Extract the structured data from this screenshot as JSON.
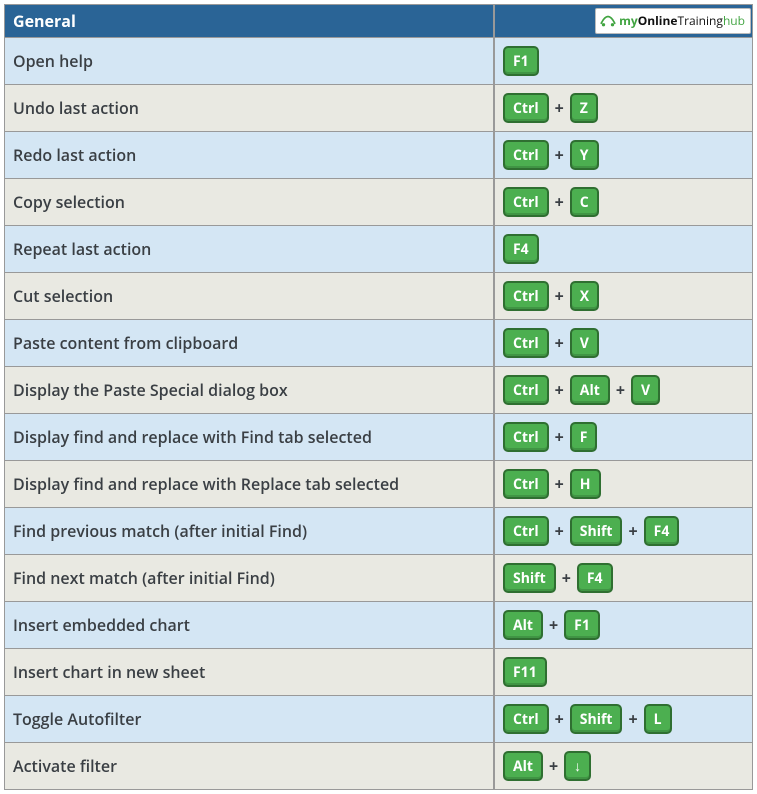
{
  "header": {
    "title": "General",
    "logo_parts": {
      "my": "my",
      "online": "Online",
      "training": "Training",
      "hub": "hub"
    }
  },
  "plus": "+",
  "rows": [
    {
      "desc": "Open help",
      "keys": [
        "F1"
      ]
    },
    {
      "desc": "Undo last action",
      "keys": [
        "Ctrl",
        "Z"
      ]
    },
    {
      "desc": "Redo last action",
      "keys": [
        "Ctrl",
        "Y"
      ]
    },
    {
      "desc": "Copy selection",
      "keys": [
        "Ctrl",
        "C"
      ]
    },
    {
      "desc": "Repeat last action",
      "keys": [
        "F4"
      ]
    },
    {
      "desc": "Cut selection",
      "keys": [
        "Ctrl",
        "X"
      ]
    },
    {
      "desc": "Paste content from clipboard",
      "keys": [
        "Ctrl",
        "V"
      ]
    },
    {
      "desc": "Display the Paste Special dialog box",
      "keys": [
        "Ctrl",
        "Alt",
        "V"
      ]
    },
    {
      "desc": "Display find and replace with Find tab selected",
      "keys": [
        "Ctrl",
        "F"
      ]
    },
    {
      "desc": "Display find and replace with Replace tab selected",
      "keys": [
        "Ctrl",
        "H"
      ]
    },
    {
      "desc": "Find previous match (after initial Find)",
      "keys": [
        "Ctrl",
        "Shift",
        "F4"
      ]
    },
    {
      "desc": "Find next match (after initial Find)",
      "keys": [
        "Shift",
        "F4"
      ]
    },
    {
      "desc": "Insert embedded chart",
      "keys": [
        "Alt",
        "F1"
      ]
    },
    {
      "desc": "Insert chart in new sheet",
      "keys": [
        "F11"
      ]
    },
    {
      "desc": "Toggle Autofilter",
      "keys": [
        "Ctrl",
        "Shift",
        "L"
      ]
    },
    {
      "desc": "Activate filter",
      "keys": [
        "Alt",
        "↓"
      ]
    }
  ]
}
